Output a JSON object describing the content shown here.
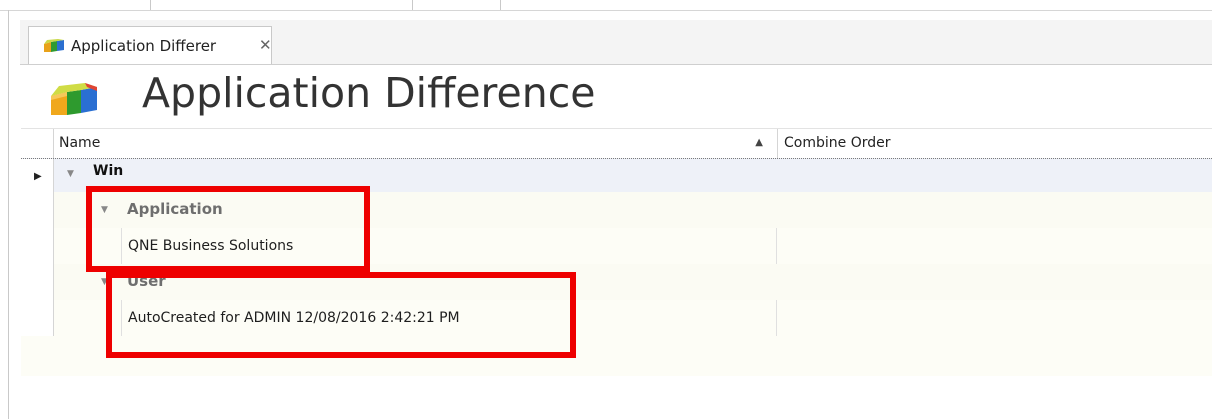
{
  "tab": {
    "label": "Application Differer",
    "close_glyph": "✕",
    "icon": "app-cubes-icon"
  },
  "header": {
    "title": "Application Difference",
    "icon": "app-cubes-icon"
  },
  "grid": {
    "columns": [
      {
        "label": "Name",
        "sort": "ascending"
      },
      {
        "label": "Combine Order"
      }
    ],
    "rows": [
      {
        "level": 0,
        "type": "group",
        "text": "Win"
      },
      {
        "level": 1,
        "type": "group",
        "text": "Application"
      },
      {
        "level": 1,
        "type": "data",
        "text": "QNE Business Solutions",
        "combine_order": ""
      },
      {
        "level": 2,
        "type": "group",
        "text": "User"
      },
      {
        "level": 2,
        "type": "data",
        "text": "AutoCreated for ADMIN 12/08/2016 2:42:21 PM",
        "combine_order": ""
      }
    ]
  },
  "colors": {
    "highlight": "#ee0000",
    "group_row_bg": "#fbfbf3",
    "focused_row_bg": "#eef1f8"
  }
}
